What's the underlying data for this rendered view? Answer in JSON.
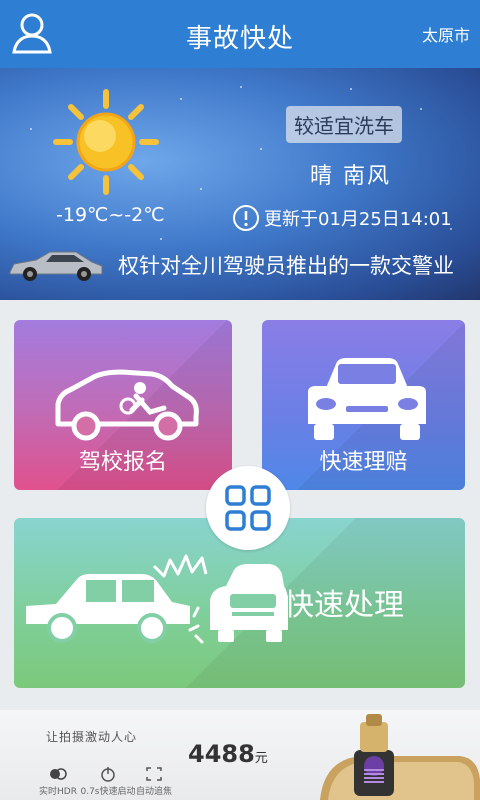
{
  "header": {
    "title": "事故快处",
    "city": "太原市",
    "avatar_icon": "user-icon"
  },
  "weather": {
    "icon": "sun-icon",
    "temperature": "-19℃~-2℃",
    "car_wash_index": "较适宜洗车",
    "condition": "晴  南风",
    "update_text": "更新于01月25日14:01",
    "update_icon": "info-icon",
    "ticker_text": "权针对全川驾驶员推出的一款交警业"
  },
  "tiles": {
    "driving_school": "驾校报名",
    "quick_claim": "快速理赔",
    "quick_handle": "快速处理"
  },
  "menu_button_icon": "grid-icon",
  "ad": {
    "slogan": "让拍摄激动人心",
    "price": "4488",
    "currency": "元",
    "features": [
      "实时HDR",
      "0.7s快速启动",
      "自动追焦"
    ]
  },
  "colors": {
    "header": "#2e7fd4",
    "tile_school": "#c26bb5",
    "tile_claim": "#6c7fe6",
    "tile_handle": "#7fcf9c",
    "grid_icon": "#2e7fd4"
  }
}
